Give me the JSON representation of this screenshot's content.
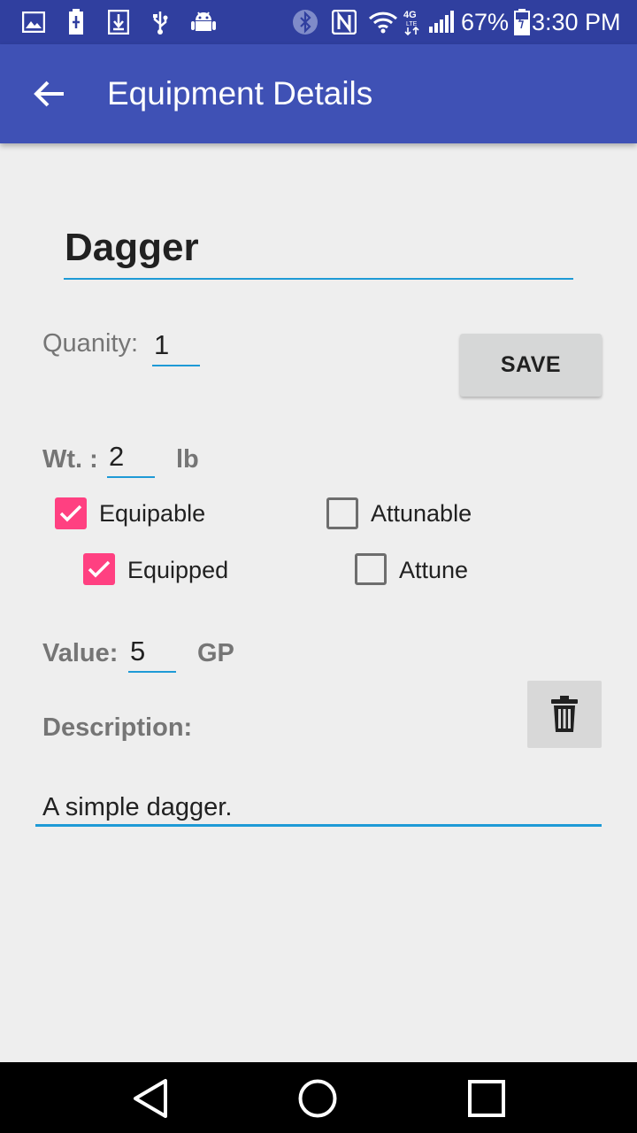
{
  "status_bar": {
    "icons": [
      "gallery-icon",
      "battery-saver-icon",
      "download-icon",
      "usb-icon",
      "android-icon",
      "bluetooth-icon",
      "nfc-icon",
      "wifi-icon",
      "lte-icon",
      "signal-icon",
      "battery-icon"
    ],
    "network": "4G",
    "battery": "67%",
    "time": "3:30 PM"
  },
  "app_bar": {
    "title": "Equipment Details",
    "back_icon": "arrow-back-icon"
  },
  "form": {
    "name": "Dagger",
    "quantity_label": "Quanity:",
    "quantity_value": "1",
    "save_label": "SAVE",
    "weight_label": "Wt. :",
    "weight_value": "2",
    "weight_unit": "lb",
    "value_label": "Value:",
    "value_value": "5",
    "value_unit": "GP",
    "description_label": "Description:",
    "description_value": "A simple dagger.",
    "delete_icon": "trash-icon",
    "checkboxes": [
      {
        "label": "Equipable",
        "checked": true
      },
      {
        "label": "Attunable",
        "checked": false
      },
      {
        "label": "Equipped",
        "checked": true
      },
      {
        "label": "Attune",
        "checked": false
      }
    ]
  },
  "colors": {
    "primary": "#3f51b5",
    "primary_dark": "#303f9f",
    "accent": "#ff4081",
    "underline": "#1e9ad6",
    "background": "#eeeeee"
  },
  "nav_bar": {
    "icons": [
      "back-triangle-icon",
      "home-circle-icon",
      "recents-square-icon"
    ]
  }
}
